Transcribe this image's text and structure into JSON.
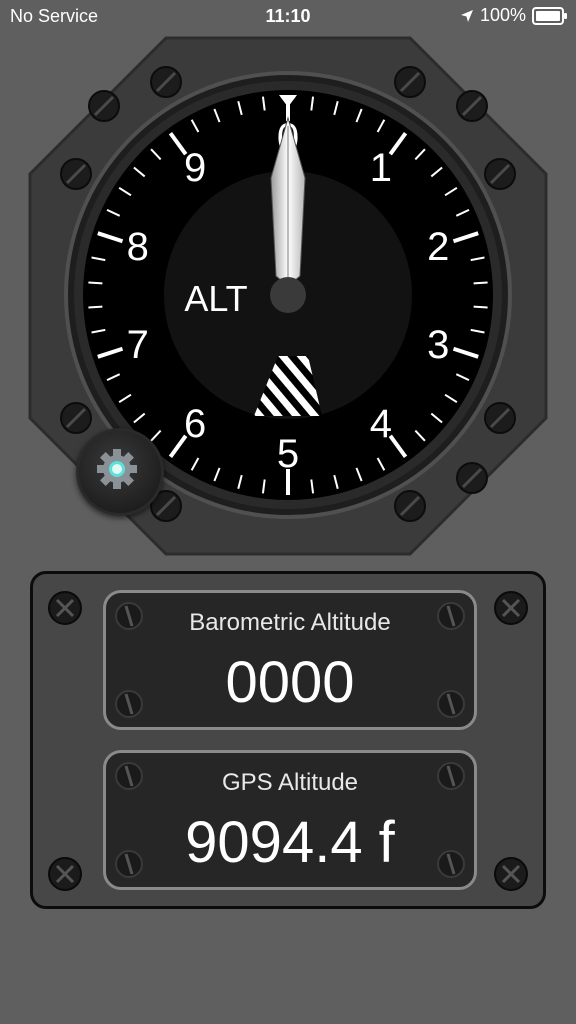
{
  "status_bar": {
    "carrier": "No Service",
    "time": "11:10",
    "battery_pct": "100%"
  },
  "gauge": {
    "label": "ALT",
    "dial_numbers": [
      "0",
      "1",
      "2",
      "3",
      "4",
      "5",
      "6",
      "7",
      "8",
      "9"
    ],
    "hundreds_needle_value": 0
  },
  "settings": {
    "icon": "gear-icon"
  },
  "readouts": {
    "barometric": {
      "label": "Barometric Altitude",
      "value": "0000"
    },
    "gps": {
      "label": "GPS Altitude",
      "value": "9094.4 f"
    }
  },
  "colors": {
    "background": "#5f5f5f",
    "gauge_face": "#000000",
    "gear_accent": "#5fe0d6"
  }
}
